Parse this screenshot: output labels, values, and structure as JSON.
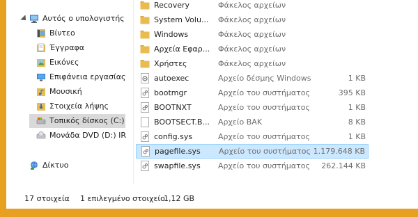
{
  "navigation": {
    "computer_label": "Αυτός ο υπολογιστής",
    "items": [
      {
        "label": "Βίντεο",
        "icon": "video-folder-icon"
      },
      {
        "label": "Έγγραφα",
        "icon": "documents-folder-icon"
      },
      {
        "label": "Εικόνες",
        "icon": "pictures-folder-icon"
      },
      {
        "label": "Επιφάνεια εργασίας",
        "icon": "desktop-folder-icon"
      },
      {
        "label": "Μουσική",
        "icon": "music-folder-icon"
      },
      {
        "label": "Στοιχεία λήψης",
        "icon": "downloads-folder-icon"
      },
      {
        "label": "Τοπικός δίσκος (C:)",
        "icon": "local-disk-icon"
      },
      {
        "label": "Μονάδα DVD (D:) IR",
        "icon": "dvd-drive-icon"
      }
    ],
    "network_label": "Δίκτυο"
  },
  "files": [
    {
      "name": "Recovery",
      "type": "Φάκελος αρχείων",
      "size": "",
      "kind": "folder"
    },
    {
      "name": "System Volu...",
      "type": "Φάκελος αρχείων",
      "size": "",
      "kind": "folder"
    },
    {
      "name": "Windows",
      "type": "Φάκελος αρχείων",
      "size": "",
      "kind": "folder"
    },
    {
      "name": "Αρχεία Εφαρ...",
      "type": "Φάκελος αρχείων",
      "size": "",
      "kind": "folder"
    },
    {
      "name": "Χρήστες",
      "type": "Φάκελος αρχείων",
      "size": "",
      "kind": "folder"
    },
    {
      "name": "autoexec",
      "type": "Αρχείο δέσμης Windows",
      "size": "1 KB",
      "kind": "batch"
    },
    {
      "name": "bootmgr",
      "type": "Αρχείο του συστήματος",
      "size": "395 KB",
      "kind": "system"
    },
    {
      "name": "BOOTNXT",
      "type": "Αρχείο του συστήματος",
      "size": "1 KB",
      "kind": "system"
    },
    {
      "name": "BOOTSECT.B...",
      "type": "Αρχείο BAK",
      "size": "8 KB",
      "kind": "file"
    },
    {
      "name": "config.sys",
      "type": "Αρχείο του συστήματος",
      "size": "1 KB",
      "kind": "system"
    },
    {
      "name": "pagefile.sys",
      "type": "Αρχείο του συστήματος",
      "size": "1.179.648 KB",
      "kind": "system"
    },
    {
      "name": "swapfile.sys",
      "type": "Αρχείο του συστήματος",
      "size": "262.144 KB",
      "kind": "system"
    }
  ],
  "status": {
    "item_count": "17 στοιχεία",
    "selection": "1 επιλεγμένο στοιχείο",
    "selection_size": "1,12 GB"
  },
  "colors": {
    "frame": "#e8a020",
    "selection_bg": "#cce8ff",
    "selection_border": "#99d1ff",
    "folder": "#e8bc50"
  }
}
